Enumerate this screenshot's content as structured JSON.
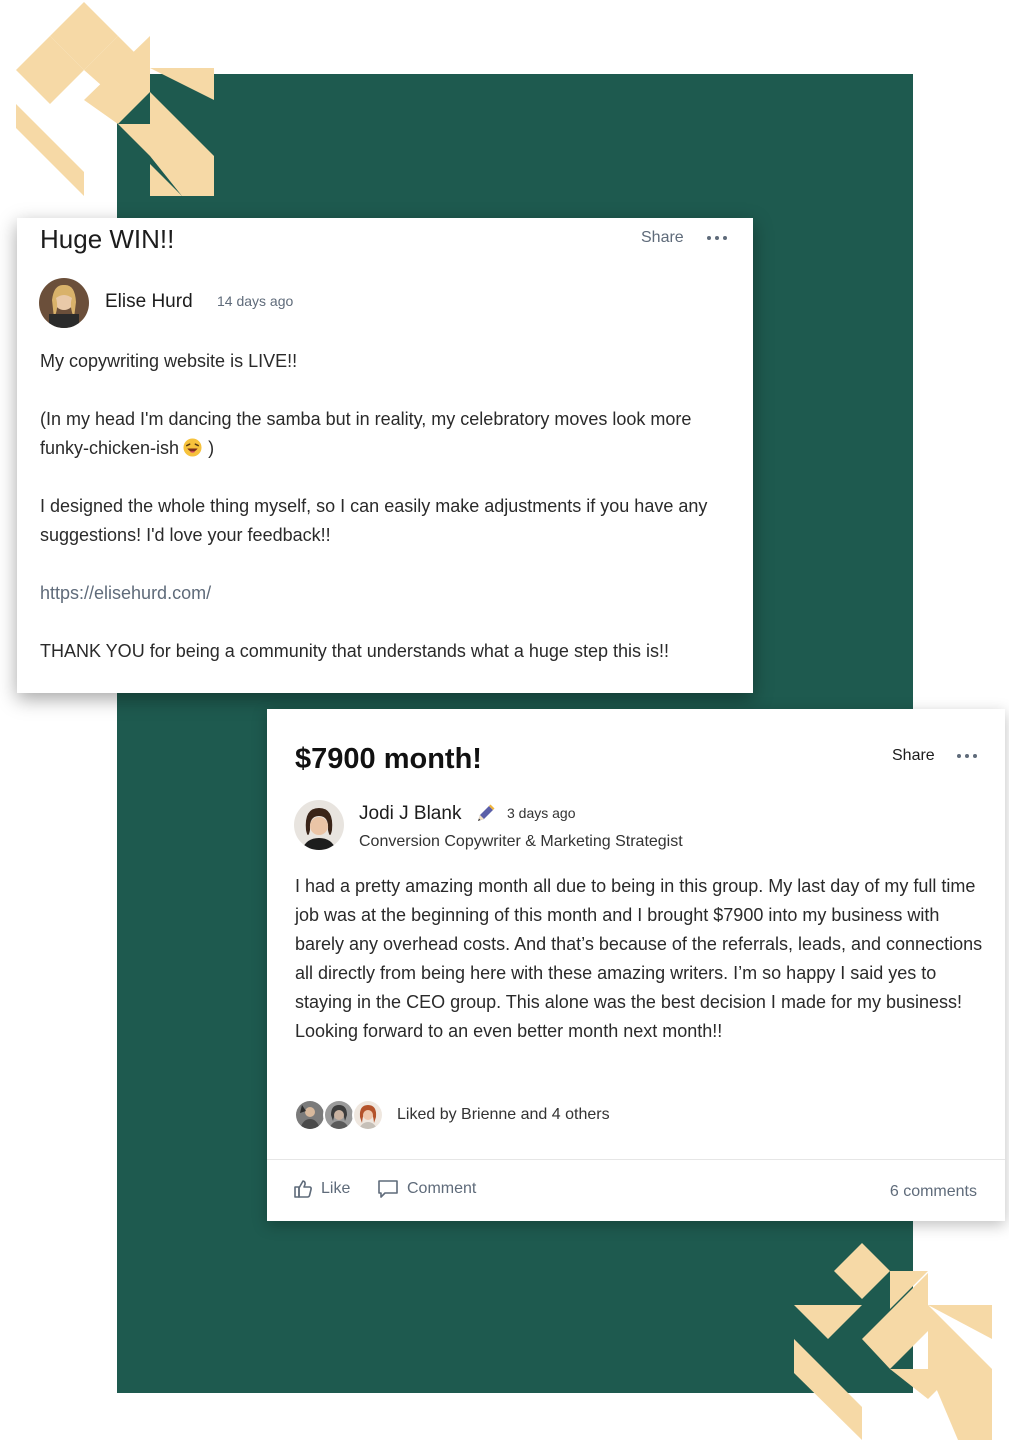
{
  "colors": {
    "background_panel": "#1e5a4f",
    "decor": "#f6d9a6",
    "muted_text": "#5f6b7a"
  },
  "post_1": {
    "title": "Huge WIN!!",
    "share_label": "Share",
    "more_icon": "ellipsis-icon",
    "author": {
      "name": "Elise Hurd",
      "time": "14 days ago"
    },
    "body": {
      "p1": "My copywriting website is LIVE!!",
      "p2": "(In my head I'm dancing the samba but in reality, my celebratory moves look more funky-chicken-ish",
      "p2_end": ")",
      "p3": "I designed the whole thing myself, so I can easily make adjustments if you have any suggestions! I'd love your feedback!!",
      "link": "https://elisehurd.com/",
      "p4": "THANK YOU for being a community that understands what a huge step this is!!"
    }
  },
  "post_2": {
    "title": "$7900 month!",
    "share_label": "Share",
    "more_icon": "ellipsis-icon",
    "author": {
      "name": "Jodi J Blank",
      "role_icon": "pen-icon",
      "time": "3 days ago",
      "role": "Conversion Copywriter & Marketing Strategist"
    },
    "body": "I had a pretty amazing month all due to being in this group. My last day of my full time job was at the beginning of this month and I brought $7900 into my business with barely any overhead costs. And that’s because of the referrals, leads, and connections all directly from being here with these amazing writers. I’m so happy I said yes to staying in the CEO group. This alone was the best decision I made for my business! Looking forward to an even better month next month!!",
    "liked_by": "Liked by Brienne and 4 others",
    "actions": {
      "like": "Like",
      "comment": "Comment",
      "comments_count": "6 comments"
    }
  }
}
